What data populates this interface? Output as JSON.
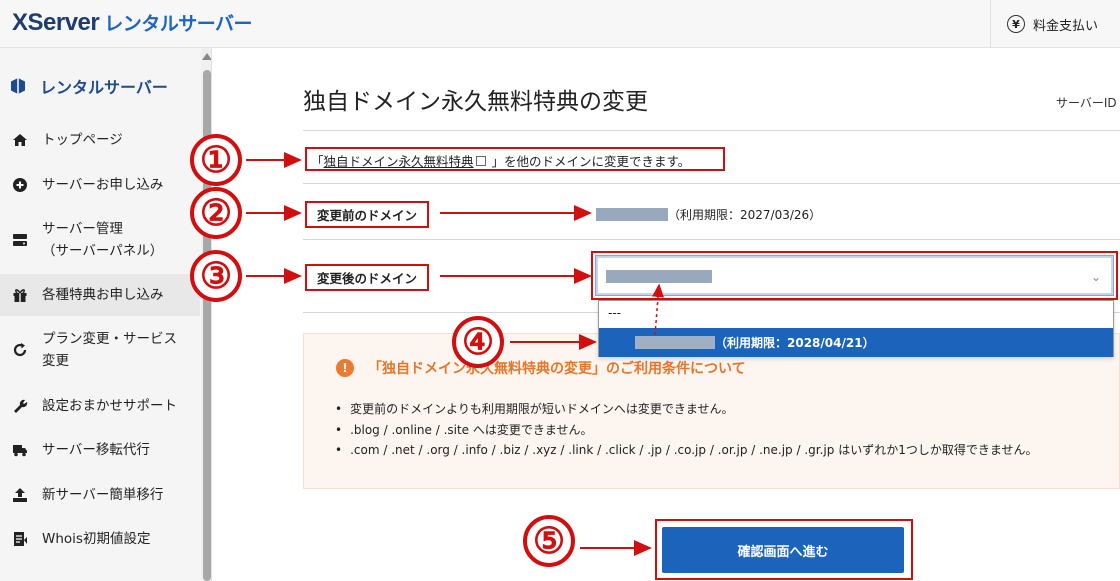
{
  "header": {
    "logo_main": "XServer",
    "logo_sub": "レンタルサーバー",
    "pay_label": "料金支払い",
    "pay_icon": "yen-icon"
  },
  "sidebar": {
    "title": "レンタルサーバー",
    "items": [
      {
        "label": "トップページ",
        "sub": "",
        "icon": "home-icon"
      },
      {
        "label": "サーバーお申し込み",
        "sub": "",
        "icon": "plus-circle-icon"
      },
      {
        "label": "サーバー管理",
        "sub": "（サーバーパネル）",
        "icon": "server-icon"
      },
      {
        "label": "各種特典お申し込み",
        "sub": "",
        "icon": "gift-icon"
      },
      {
        "label": "プラン変更・サービス",
        "sub": "変更",
        "icon": "refresh-icon"
      },
      {
        "label": "設定おまかせサポート",
        "sub": "",
        "icon": "wrench-icon"
      },
      {
        "label": "サーバー移転代行",
        "sub": "",
        "icon": "truck-icon"
      },
      {
        "label": "新サーバー簡単移行",
        "sub": "",
        "icon": "upload-icon"
      },
      {
        "label": "Whois初期値設定",
        "sub": "",
        "icon": "document-icon"
      }
    ]
  },
  "main": {
    "title": "独自ドメイン永久無料特典の変更",
    "server_id_label": "サーバーID",
    "desc_prefix": "「",
    "desc_link": "独自ドメイン永久無料特典",
    "desc_suffix": " 」を他のドメインに変更できます。",
    "before_label": "変更前のドメイン",
    "before_expiry": "（利用期限：2027/03/26）",
    "after_label": "変更後のドメイン",
    "dropdown_opt1": "---",
    "dropdown_opt2_expiry": "（利用期限：2028/04/21）",
    "notice_title": "「独自ドメイン永久無料特典の変更」のご利用条件について",
    "notice_items": [
      "変更前のドメインよりも利用期限が短いドメインへは変更できません。",
      ".blog / .online / .site へは変更できません。",
      ".com / .net / .org / .info / .biz / .xyz / .link / .click / .jp / .co.jp / .or.jp / .ne.jp / .gr.jp はいずれか1つしか取得できません。"
    ],
    "submit_label": "確認画面へ進む"
  },
  "annotations": [
    "①",
    "②",
    "③",
    "④",
    "⑤"
  ],
  "colors": {
    "annotation_red": "#d20f0f",
    "primary_blue": "#1b63bb",
    "notice_orange": "#e8762a"
  }
}
